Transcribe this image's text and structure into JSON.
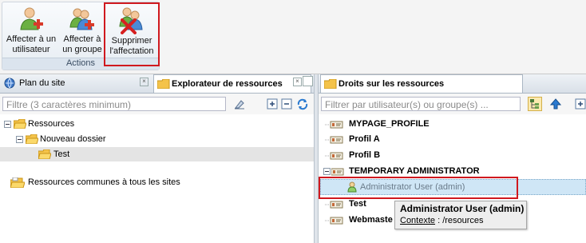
{
  "ribbon": {
    "buttons": [
      {
        "line1": "Affecter à un",
        "line2": "utilisateur"
      },
      {
        "line1": "Affecter à",
        "line2": "un groupe"
      },
      {
        "line1": "Supprimer",
        "line2": "l'affectation"
      }
    ],
    "group_label": "Actions"
  },
  "left_panel": {
    "tabs": [
      "Plan du site",
      "Explorateur de ressources"
    ],
    "filter_placeholder": "Filtre (3 caractères minimum)",
    "tree": [
      "Ressources",
      "Nouveau dossier",
      "Test",
      "Ressources communes à tous les sites"
    ]
  },
  "right_panel": {
    "tab": "Droits sur les ressources",
    "filter_placeholder": "Filtrer par utilisateur(s) ou groupe(s) ...",
    "tree": [
      "MYPAGE_PROFILE",
      "Profil A",
      "Profil B",
      "TEMPORARY ADMINISTRATOR",
      "Administrator User (admin)",
      "Test",
      "Webmaste"
    ]
  },
  "tooltip": {
    "title": "Administrator User (admin)",
    "context_label": "Contexte",
    "context_value": " : /resources"
  },
  "colors": {
    "highlight_red": "#d0191f",
    "selected_row": "#cfe6f6",
    "selected_left": "#e4e4e4"
  }
}
